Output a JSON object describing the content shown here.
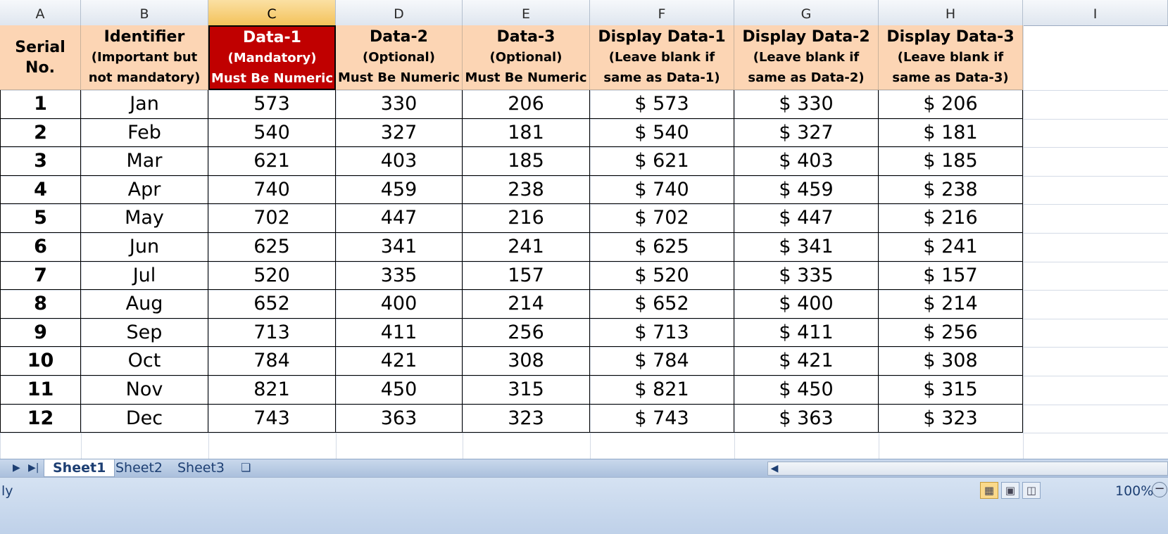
{
  "columns": [
    "A",
    "B",
    "C",
    "D",
    "E",
    "F",
    "G",
    "H",
    "I"
  ],
  "selected_column": "C",
  "headers": [
    {
      "lines": [
        "Serial",
        "No."
      ]
    },
    {
      "lines": [
        "Identifier",
        "(Important but",
        "not mandatory)"
      ]
    },
    {
      "lines": [
        "Data-1",
        "(Mandatory)",
        "Must Be Numeric"
      ]
    },
    {
      "lines": [
        "Data-2",
        "(Optional)",
        "Must Be Numeric"
      ]
    },
    {
      "lines": [
        "Data-3",
        "(Optional)",
        "Must Be Numeric"
      ]
    },
    {
      "lines": [
        "Display Data-1",
        "(Leave blank if",
        "same as Data-1)"
      ]
    },
    {
      "lines": [
        "Display Data-2",
        "(Leave blank if",
        "same as Data-2)"
      ]
    },
    {
      "lines": [
        "Display Data-3",
        "(Leave blank if",
        "same as Data-3)"
      ]
    }
  ],
  "rows": [
    [
      "1",
      "Jan",
      "573",
      "330",
      "206",
      "$ 573",
      "$ 330",
      "$ 206"
    ],
    [
      "2",
      "Feb",
      "540",
      "327",
      "181",
      "$ 540",
      "$ 327",
      "$ 181"
    ],
    [
      "3",
      "Mar",
      "621",
      "403",
      "185",
      "$ 621",
      "$ 403",
      "$ 185"
    ],
    [
      "4",
      "Apr",
      "740",
      "459",
      "238",
      "$ 740",
      "$ 459",
      "$ 238"
    ],
    [
      "5",
      "May",
      "702",
      "447",
      "216",
      "$ 702",
      "$ 447",
      "$ 216"
    ],
    [
      "6",
      "Jun",
      "625",
      "341",
      "241",
      "$ 625",
      "$ 341",
      "$ 241"
    ],
    [
      "7",
      "Jul",
      "520",
      "335",
      "157",
      "$ 520",
      "$ 335",
      "$ 157"
    ],
    [
      "8",
      "Aug",
      "652",
      "400",
      "214",
      "$ 652",
      "$ 400",
      "$ 214"
    ],
    [
      "9",
      "Sep",
      "713",
      "411",
      "256",
      "$ 713",
      "$ 411",
      "$ 256"
    ],
    [
      "10",
      "Oct",
      "784",
      "421",
      "308",
      "$ 784",
      "$ 421",
      "$ 308"
    ],
    [
      "11",
      "Nov",
      "821",
      "450",
      "315",
      "$ 821",
      "$ 450",
      "$ 315"
    ],
    [
      "12",
      "Dec",
      "743",
      "363",
      "323",
      "$ 743",
      "$ 363",
      "$ 323"
    ]
  ],
  "sheet_tabs": [
    "Sheet1",
    "Sheet2",
    "Sheet3"
  ],
  "active_sheet": "Sheet1",
  "status": {
    "text": "ly",
    "zoom": "100%"
  },
  "colors": {
    "header_fill": "#fcd5b4",
    "mandatory_fill": "#c00000",
    "selected_column": "#f3c25a"
  }
}
